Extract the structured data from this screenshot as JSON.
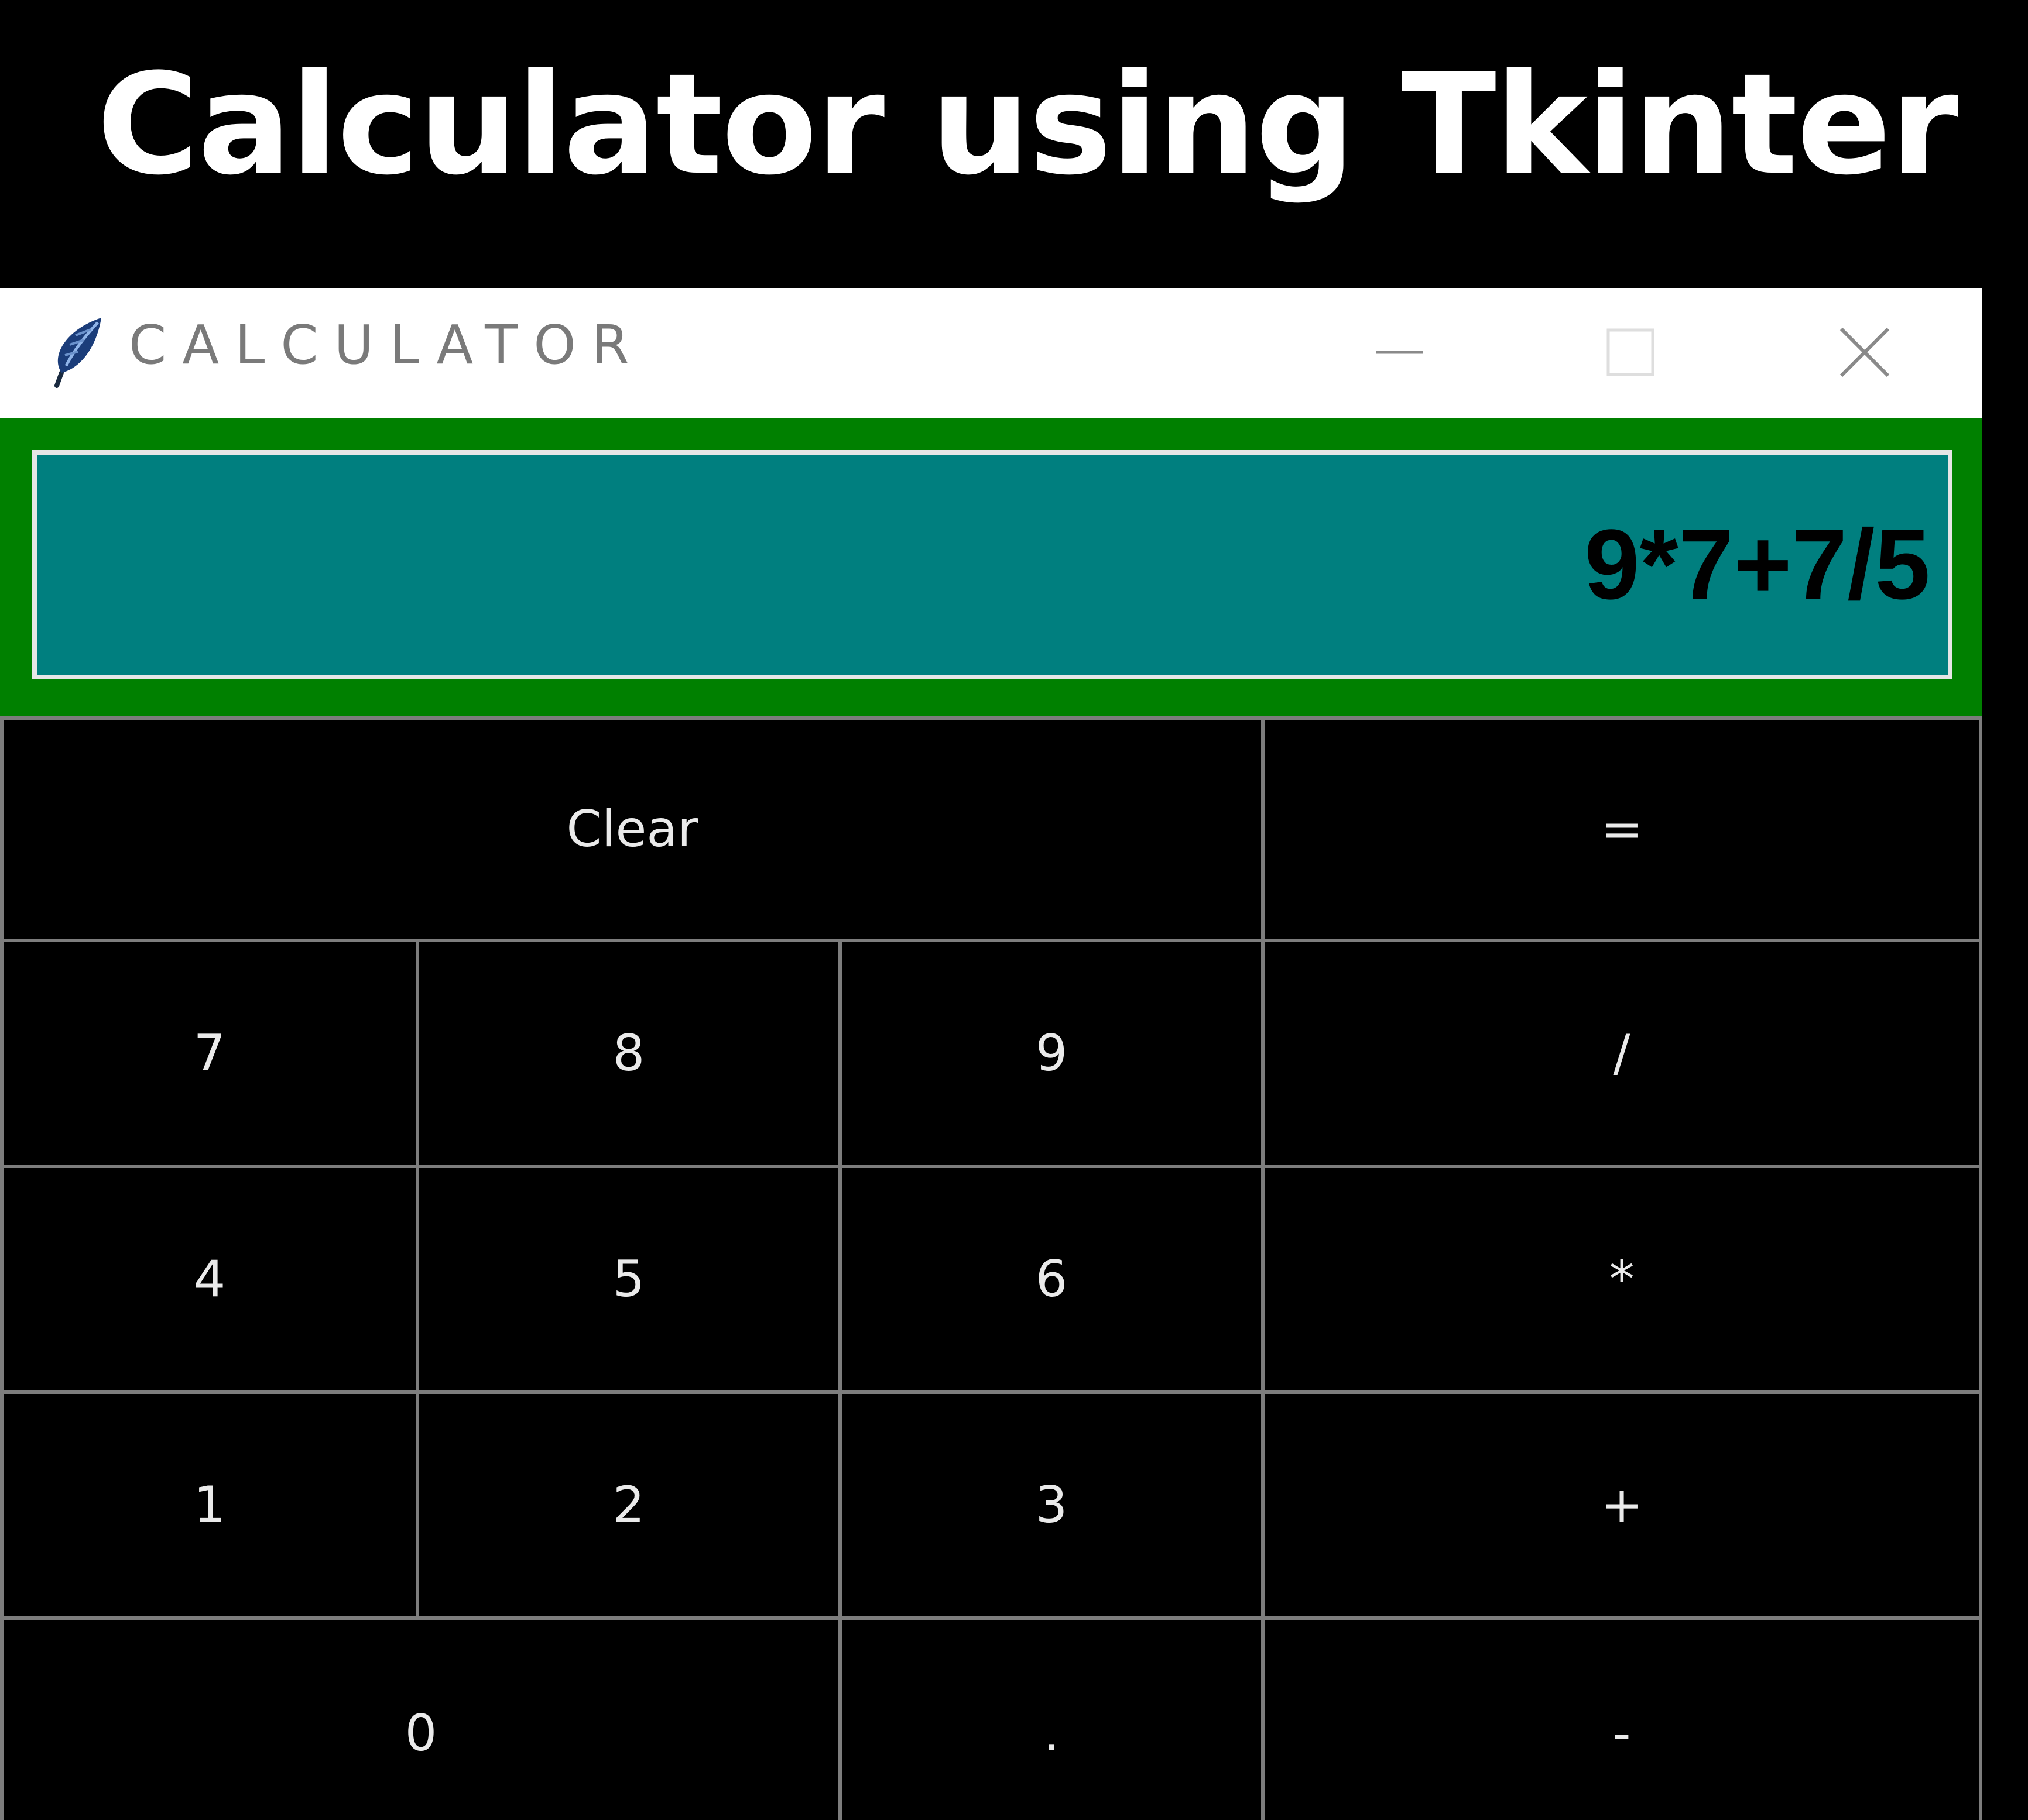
{
  "headline": "Calculator using Tkinter",
  "window": {
    "title": "CALCULATOR",
    "icon": "feather-icon",
    "controls": {
      "minimize": "minimize-icon",
      "maximize": "maximize-icon",
      "close": "close-icon"
    }
  },
  "display": {
    "value": "9*7+7/5"
  },
  "keys": {
    "clear": "Clear",
    "equals": "=",
    "seven": "7",
    "eight": "8",
    "nine": "9",
    "divide": "/",
    "four": "4",
    "five": "5",
    "six": "6",
    "multiply": "*",
    "one": "1",
    "two": "2",
    "three": "3",
    "plus": "+",
    "zero": "0",
    "dot": ".",
    "minus": "-"
  },
  "colors": {
    "page_background": "#000000",
    "display_frame": "#008000",
    "display_background": "#007f7f",
    "key_background": "#000000",
    "key_border": "#7d7d7d",
    "key_text": "#eaeaea"
  }
}
